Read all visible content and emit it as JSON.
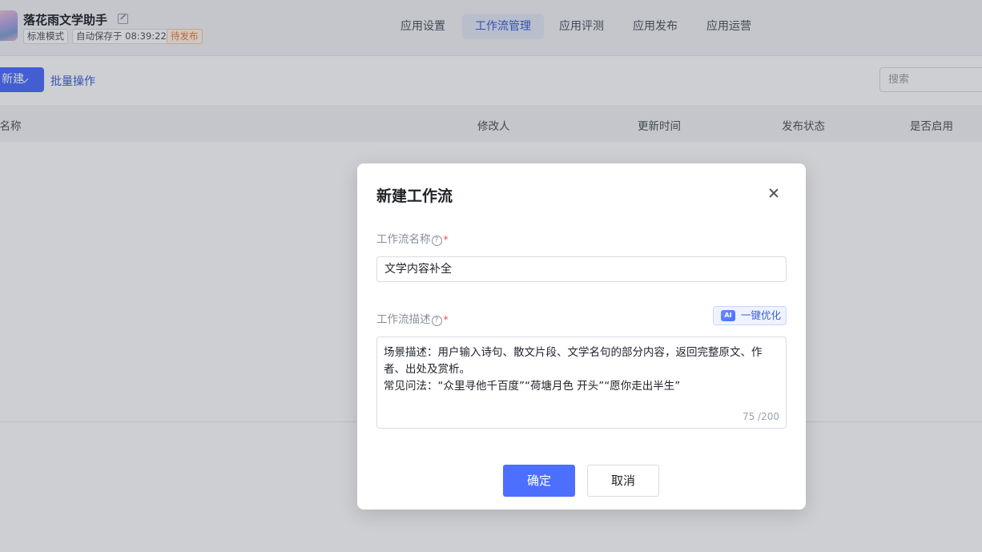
{
  "header": {
    "app_title": "落花雨文学助手",
    "tags": {
      "mode": "标准模式",
      "autosave": "自动保存于 08:39:22",
      "status": "待发布"
    },
    "nav_tabs": [
      {
        "label": "应用设置"
      },
      {
        "label": "工作流管理"
      },
      {
        "label": "应用评测"
      },
      {
        "label": "应用发布"
      },
      {
        "label": "应用运营"
      }
    ],
    "active_tab": "工作流管理"
  },
  "toolbar": {
    "new_label": "新建",
    "bulk_label": "批量操作",
    "search_placeholder": "搜索"
  },
  "table": {
    "columns": [
      "流名称",
      "修改人",
      "更新时间",
      "发布状态",
      "是否启用"
    ]
  },
  "modal": {
    "title": "新建工作流",
    "name_label": "工作流名称",
    "name_value": "文学内容补全",
    "desc_label": "工作流描述",
    "ai_optimize_label": "一键优化",
    "ai_badge": "AI",
    "help_glyph": "?",
    "required_mark": "*",
    "desc_value": "场景描述：用户输入诗句、散文片段、文学名句的部分内容，返回完整原文、作者、出处及赏析。\n常见问法：“众里寻他千百度”“荷塘月色 开头”“愿你走出半生”",
    "char_count": "75 /200",
    "ok_label": "确定",
    "cancel_label": "取消"
  },
  "colors": {
    "primary": "#4c6fff",
    "active_tab_bg": "#e4e9f7",
    "pending_tag": "#f07b2e",
    "required": "#f54a45"
  }
}
